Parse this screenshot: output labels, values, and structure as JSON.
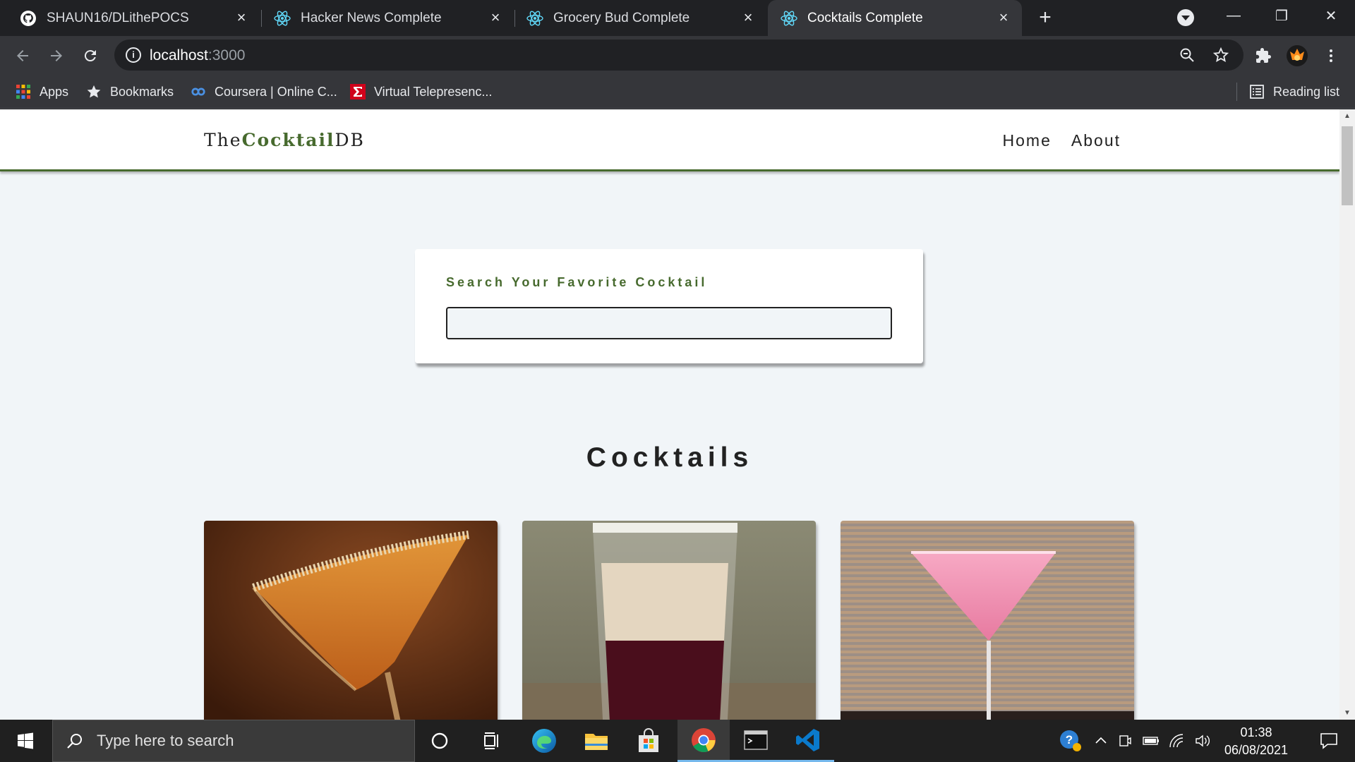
{
  "tabs": [
    {
      "title": "SHAUN16/DLithePOCS",
      "icon": "github-icon"
    },
    {
      "title": "Hacker News Complete",
      "icon": "react-icon"
    },
    {
      "title": "Grocery Bud Complete",
      "icon": "react-icon"
    },
    {
      "title": "Cocktails Complete",
      "icon": "react-icon",
      "active": true
    }
  ],
  "newtab_label": "+",
  "address": {
    "host": "localhost",
    "port": ":3000"
  },
  "bookmarks": {
    "apps": "Apps",
    "bookmarks": "Bookmarks",
    "coursera": "Coursera | Online C...",
    "virtual": "Virtual Telepresenc...",
    "reading_list": "Reading list"
  },
  "navbar": {
    "logo_prefix": "The",
    "logo_brand": "Cocktail",
    "logo_suffix": "DB",
    "links": [
      "Home",
      "About"
    ]
  },
  "search": {
    "label": "Search Your Favorite Cocktail",
    "value": ""
  },
  "section_title": "Cocktails",
  "cocktails": [
    {
      "image": "orange-martini-sugar-rim"
    },
    {
      "image": "layered-shot-red-cream"
    },
    {
      "image": "pink-martini"
    }
  ],
  "taskbar": {
    "search_placeholder": "Type here to search",
    "time": "01:38",
    "date": "06/08/2021"
  },
  "colors": {
    "brand_green": "#476a2e",
    "page_bg": "#f1f5f8",
    "chrome_dark": "#202124",
    "chrome_toolbar": "#35363a"
  }
}
